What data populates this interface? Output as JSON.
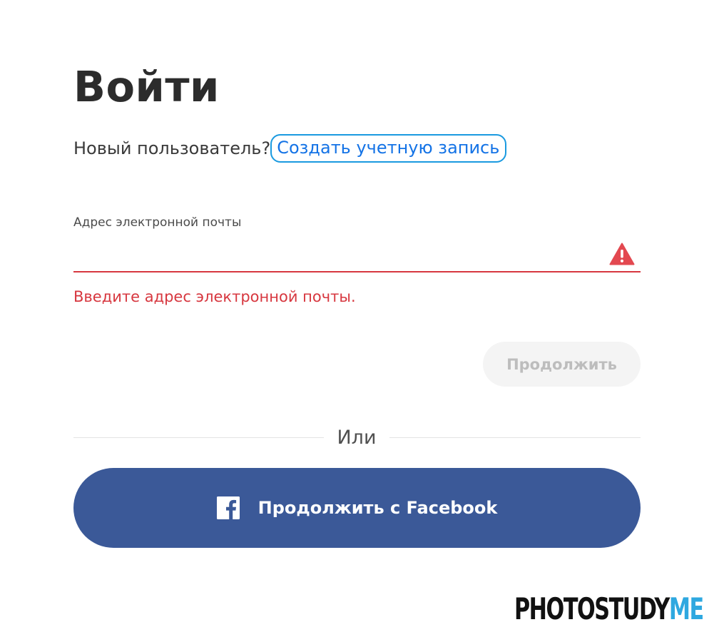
{
  "page": {
    "title": "Войти"
  },
  "signup": {
    "prompt": "Новый пользователь?",
    "link_label": "Создать учетную запись"
  },
  "email": {
    "label": "Адрес электронной почты",
    "value": "",
    "placeholder": "",
    "state": "error",
    "icon": "warning-triangle-icon",
    "error_message": "Введите адрес электронной почты."
  },
  "actions": {
    "continue_label": "Продолжить",
    "continue_enabled": false,
    "divider_label": "Или",
    "facebook_label": "Продолжить с Facebook",
    "facebook_icon": "facebook-icon"
  },
  "watermark": {
    "part1": "PHOTOSTUDY",
    "part2": "ME"
  },
  "colors": {
    "link": "#1473e6",
    "focus_ring": "#1a9ae0",
    "error": "#d7373f",
    "warning_icon": "#e34850",
    "facebook": "#3b5998",
    "disabled_button_bg": "#f4f4f4",
    "disabled_button_text": "#bdbdbd",
    "watermark_accent": "#2ea8e0"
  }
}
